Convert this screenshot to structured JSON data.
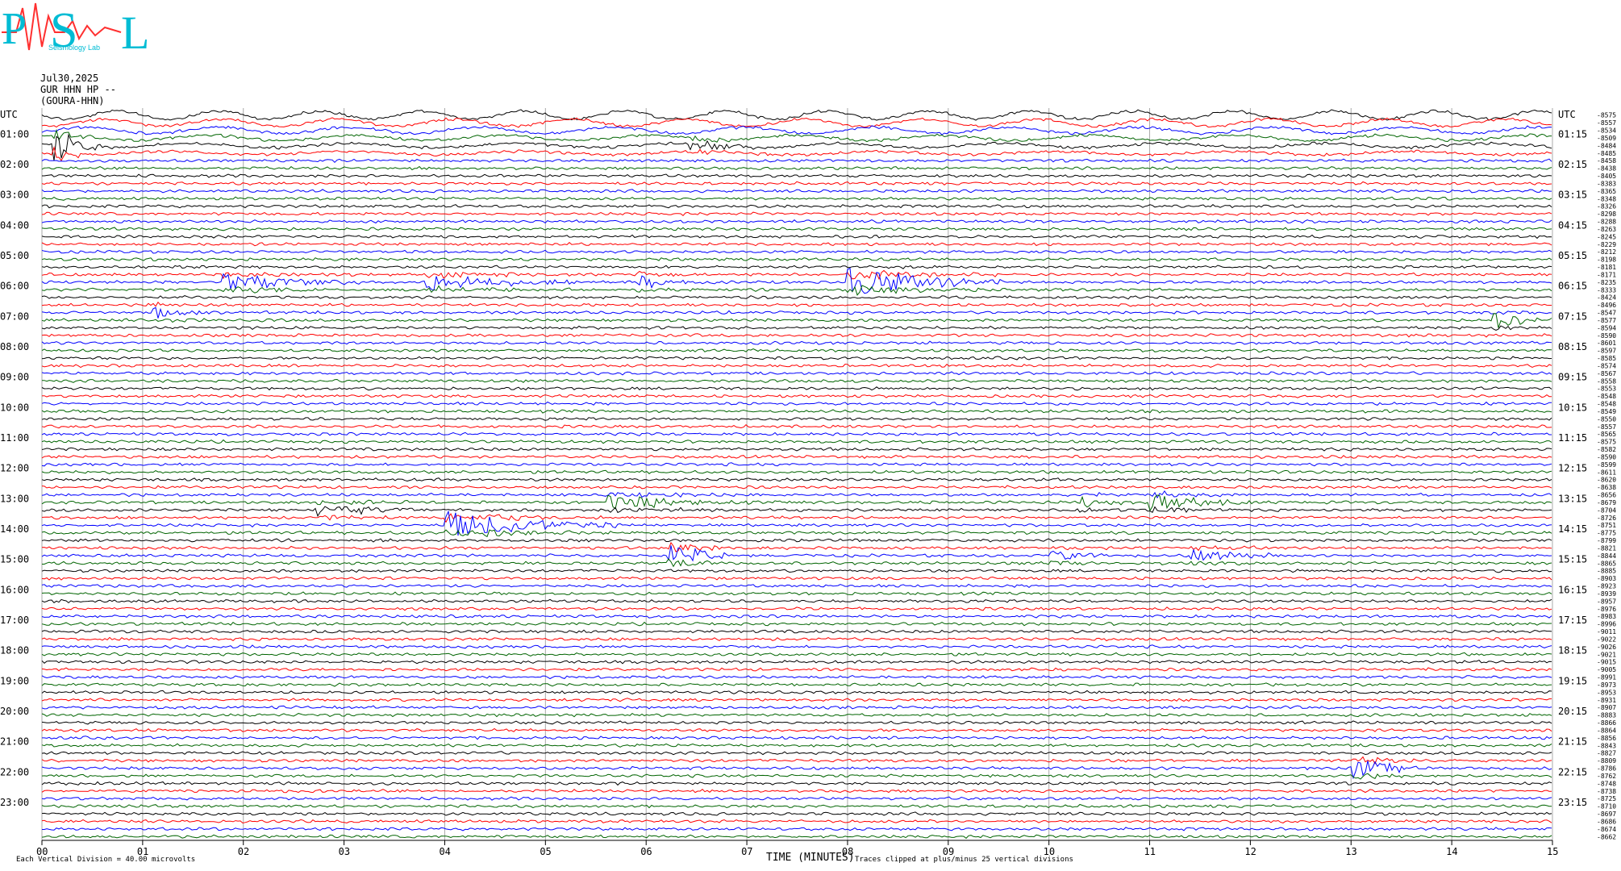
{
  "logo": {
    "letters": [
      "P",
      "S",
      "L"
    ],
    "subtitle": "Seismology Lab"
  },
  "header": {
    "date": "Jul30,2025",
    "station": "GUR HHN HP --",
    "network": "(GOURA-HHN)"
  },
  "colors": {
    "trace_cycle": [
      "#000000",
      "#ff0000",
      "#0000ff",
      "#006400"
    ],
    "logo_primary": "#00bcd4",
    "logo_accent": "#ff3030"
  },
  "chart_data": {
    "type": "line",
    "title": "",
    "left_axis_label": "UTC",
    "right_axis_label": "UTC",
    "xlabel": "TIME (MINUTES)",
    "xlim": [
      0,
      15
    ],
    "x_ticks": [
      "00",
      "01",
      "02",
      "03",
      "04",
      "05",
      "06",
      "07",
      "08",
      "09",
      "10",
      "11",
      "12",
      "13",
      "14",
      "15"
    ],
    "grid_vertical": true,
    "line_interval_minutes": 15,
    "left_labels": [
      "01:00",
      "02:00",
      "03:00",
      "04:00",
      "05:00",
      "06:00",
      "07:00",
      "08:00",
      "09:00",
      "10:00",
      "11:00",
      "12:00",
      "13:00",
      "14:00",
      "15:00",
      "16:00",
      "17:00",
      "18:00",
      "19:00",
      "20:00",
      "21:00",
      "22:00",
      "23:00"
    ],
    "right_labels": [
      "01:15",
      "02:15",
      "03:15",
      "04:15",
      "05:15",
      "06:15",
      "07:15",
      "08:15",
      "09:15",
      "10:15",
      "11:15",
      "12:15",
      "13:15",
      "14:15",
      "15:15",
      "16:15",
      "17:15",
      "18:15",
      "19:15",
      "20:15",
      "21:15",
      "22:15",
      "23:15"
    ],
    "line_counts": [
      -8575,
      -8557,
      -8534,
      -8509,
      -8484,
      -8485,
      -8458,
      -8438,
      -8405,
      -8383,
      -8365,
      -8348,
      -8326,
      -8298,
      -8288,
      -8263,
      -8245,
      -8229,
      -8212,
      -8198,
      -8181,
      -8171,
      -8235,
      -8333,
      -8424,
      -8496,
      -8547,
      -8577,
      -8594,
      -8590,
      -8601,
      -8597,
      -8585,
      -8574,
      -8567,
      -8558,
      -8553,
      -8548,
      -8548,
      -8549,
      -8550,
      -8557,
      -8565,
      -8575,
      -8582,
      -8590,
      -8599,
      -8611,
      -8620,
      -8638,
      -8656,
      -8679,
      -8704,
      -8726,
      -8751,
      -8775,
      -8799,
      -8821,
      -8844,
      -8865,
      -8885,
      -8903,
      -8923,
      -8939,
      -8957,
      -8976,
      -8983,
      -8996,
      -9011,
      -9022,
      -9026,
      -9021,
      -9015,
      -9005,
      -8991,
      -8973,
      -8953,
      -8931,
      -8907,
      -8883,
      -8866,
      -8864,
      -8856,
      -8843,
      -8827,
      -8809,
      -8786,
      -8762,
      -8748,
      -8738,
      -8725,
      -8710,
      -8697,
      -8686,
      -8674,
      -8662
    ],
    "footer_left": "Each Vertical Division =   40.00 microvolts",
    "footer_right": "Traces clipped at plus/minus 25 vertical divisions",
    "events": [
      {
        "start_hour": 0.9,
        "minute": 6.4,
        "duration_min": 0.9,
        "amplitude": 3
      },
      {
        "start_hour": 1.0,
        "minute": 0.1,
        "duration_min": 0.5,
        "amplitude": 9
      },
      {
        "start_hour": 5.6,
        "minute": 1.8,
        "duration_min": 1.4,
        "amplitude": 4
      },
      {
        "start_hour": 5.6,
        "minute": 3.8,
        "duration_min": 1.5,
        "amplitude": 4
      },
      {
        "start_hour": 5.6,
        "minute": 5.9,
        "duration_min": 0.6,
        "amplitude": 3
      },
      {
        "start_hour": 5.6,
        "minute": 8.0,
        "duration_min": 1.6,
        "amplitude": 6
      },
      {
        "start_hour": 6.5,
        "minute": 1.1,
        "duration_min": 0.6,
        "amplitude": 3
      },
      {
        "start_hour": 6.8,
        "minute": 14.4,
        "duration_min": 0.6,
        "amplitude": 4
      },
      {
        "start_hour": 12.8,
        "minute": 5.6,
        "duration_min": 1.9,
        "amplitude": 3
      },
      {
        "start_hour": 12.8,
        "minute": 10.3,
        "duration_min": 0.5,
        "amplitude": 3
      },
      {
        "start_hour": 12.8,
        "minute": 11.0,
        "duration_min": 1.0,
        "amplitude": 4
      },
      {
        "start_hour": 13.0,
        "minute": 2.7,
        "duration_min": 1.2,
        "amplitude": 3
      },
      {
        "start_hour": 13.5,
        "minute": 4.0,
        "duration_min": 1.7,
        "amplitude": 6
      },
      {
        "start_hour": 14.6,
        "minute": 6.2,
        "duration_min": 0.6,
        "amplitude": 7
      },
      {
        "start_hour": 14.6,
        "minute": 10.0,
        "duration_min": 0.6,
        "amplitude": 3
      },
      {
        "start_hour": 14.6,
        "minute": 11.4,
        "duration_min": 0.9,
        "amplitude": 3
      },
      {
        "start_hour": 21.6,
        "minute": 13.0,
        "duration_min": 0.7,
        "amplitude": 5
      }
    ]
  }
}
